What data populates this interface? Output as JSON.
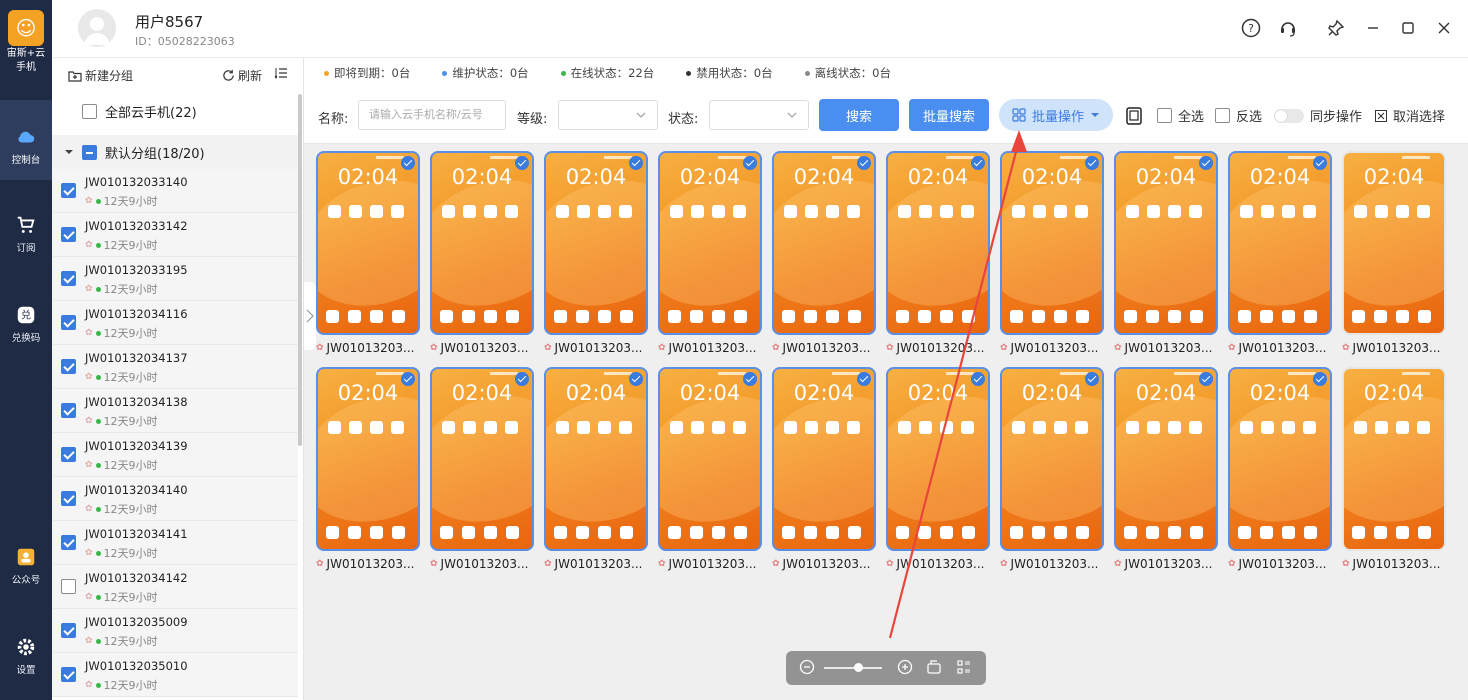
{
  "rail": {
    "brand": "宙斯+云\n手机",
    "items": [
      {
        "label": "控制台",
        "icon": "cloud-icon"
      },
      {
        "label": "订阅",
        "icon": "cart-icon"
      },
      {
        "label": "兑换码",
        "icon": "redeem-icon"
      },
      {
        "label": "公众号",
        "icon": "wechat-account-icon"
      },
      {
        "label": "设置",
        "icon": "gear-icon"
      }
    ]
  },
  "titlebar": {
    "username": "用户8567",
    "userid": "ID：05028223063"
  },
  "sidebar": {
    "new_group": "新建分组",
    "refresh": "刷新",
    "all_phones": "全部云手机(22)",
    "default_group": "默认分组(18/20)",
    "devices": [
      {
        "name": "JW010132033140",
        "time": "12天9小时",
        "checked": true
      },
      {
        "name": "JW010132033142",
        "time": "12天9小时",
        "checked": true
      },
      {
        "name": "JW010132033195",
        "time": "12天9小时",
        "checked": true
      },
      {
        "name": "JW010132034116",
        "time": "12天9小时",
        "checked": true
      },
      {
        "name": "JW010132034137",
        "time": "12天9小时",
        "checked": true
      },
      {
        "name": "JW010132034138",
        "time": "12天9小时",
        "checked": true
      },
      {
        "name": "JW010132034139",
        "time": "12天9小时",
        "checked": true
      },
      {
        "name": "JW010132034140",
        "time": "12天9小时",
        "checked": true
      },
      {
        "name": "JW010132034141",
        "time": "12天9小时",
        "checked": true
      },
      {
        "name": "JW010132034142",
        "time": "12天9小时",
        "checked": false
      },
      {
        "name": "JW010132035009",
        "time": "12天9小时",
        "checked": true
      },
      {
        "name": "JW010132035010",
        "time": "12天9小时",
        "checked": true
      }
    ]
  },
  "status": {
    "expiring": "即将到期：0台",
    "maintenance": "维护状态：0台",
    "online": "在线状态：22台",
    "disabled": "禁用状态：0台",
    "offline": "离线状态：0台",
    "colors": {
      "expiring": "#f3a224",
      "maintenance": "#4a8ef0",
      "online": "#39b54a",
      "disabled": "#333333",
      "offline": "#888888"
    }
  },
  "filters": {
    "name_label": "名称:",
    "name_placeholder": "请输入云手机名称/云号",
    "level_label": "等级:",
    "state_label": "状态:",
    "search": "搜索",
    "batch_search": "批量搜索",
    "batch_ops": "批量操作",
    "select_all": "全选",
    "invert": "反选",
    "sync": "同步操作",
    "cancel_select": "取消选择"
  },
  "grid": {
    "clock": "02:04",
    "label": "JW01013203...",
    "rows": [
      [
        true,
        true,
        true,
        true,
        true,
        true,
        true,
        true,
        true,
        false
      ],
      [
        true,
        true,
        true,
        true,
        true,
        true,
        true,
        true,
        true,
        false
      ]
    ]
  }
}
